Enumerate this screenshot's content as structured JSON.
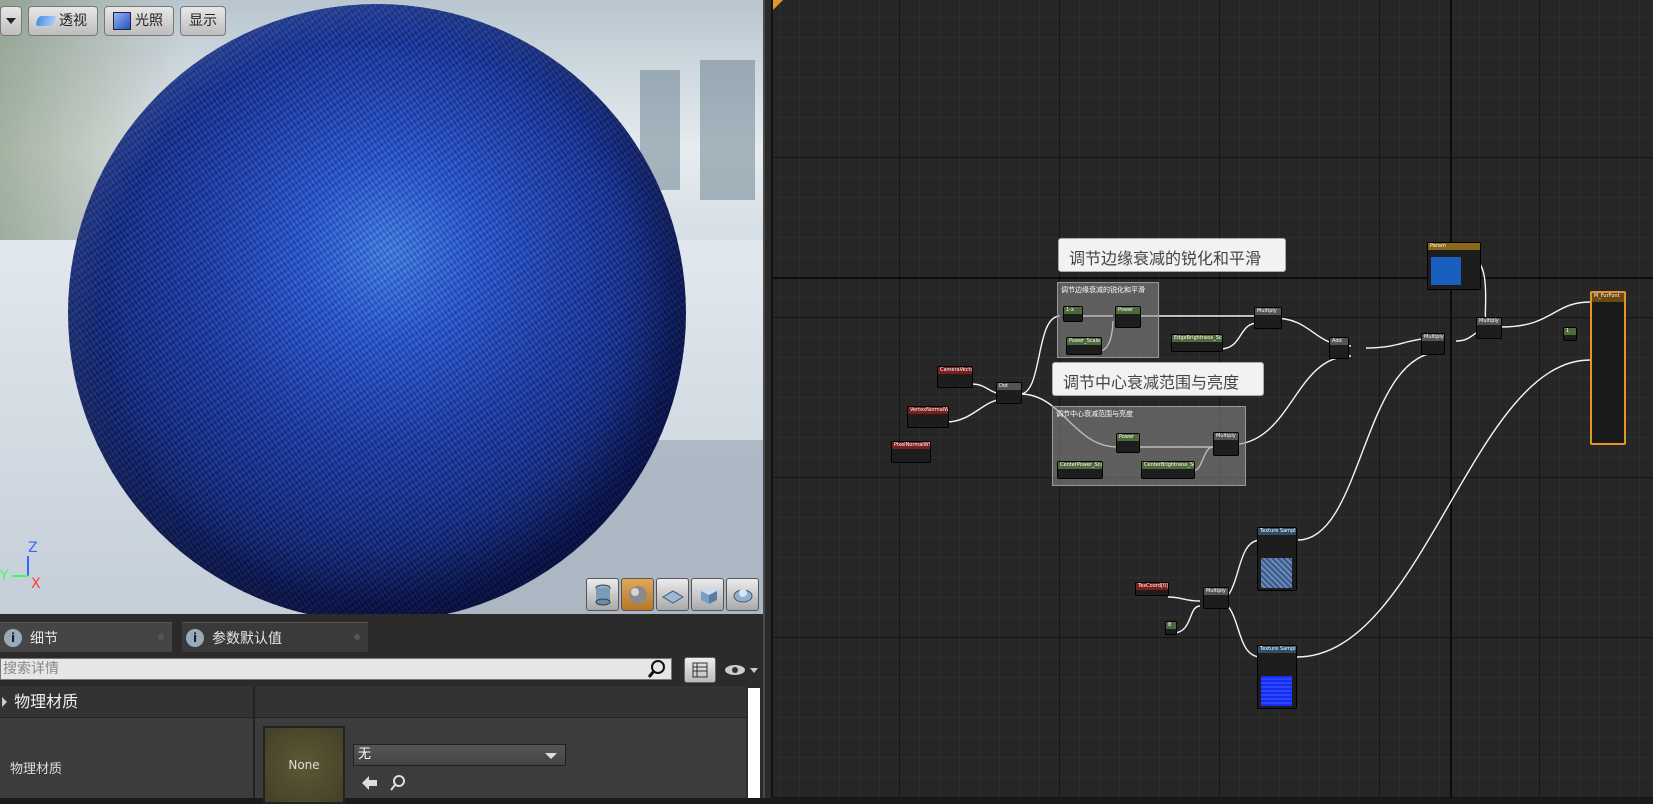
{
  "viewport": {
    "toolbar": {
      "dropdown_label": "",
      "perspective_label": "透视",
      "lighting_label": "光照",
      "show_label": "显示"
    },
    "axes": {
      "z": "Z",
      "y": "Y",
      "x": "X"
    },
    "preview_shapes": [
      "cylinder-icon",
      "sphere-icon",
      "plane-icon",
      "cube-icon",
      "custom-mesh-icon"
    ],
    "active_shape": "sphere-icon"
  },
  "details": {
    "tabs": [
      {
        "label": "细节"
      },
      {
        "label": "参数默认值"
      }
    ],
    "search_placeholder": "搜索详情",
    "section_title": "物理材质",
    "row_label": "物理材质",
    "thumbnail_text": "None",
    "combo_value": "无"
  },
  "graph": {
    "comments": [
      {
        "title": "调节边缘衰减的锐化和平滑"
      },
      {
        "title": "调节中心衰减范围与亮度"
      }
    ],
    "comment_boxes": [
      {
        "text": "调节边缘衰减的锐化和平滑"
      },
      {
        "text": "调节中心衰减范围与亮度"
      }
    ],
    "nodes": {
      "camera_vector": "CameraVector",
      "vertex_normal": "VertexNormalWS",
      "pixel_normal": "PixelNormalWS",
      "dot": "Dot",
      "one_minus": "1-x",
      "power_edge": "Power",
      "power_scale": "Power_Scale",
      "edge_brightness": "EdgeBrightness_Scale",
      "multiply_edge": "Multiply",
      "power_center": "Power",
      "center_power": "CenterPower_Scale",
      "center_brightness": "CenterBrightness_Scale",
      "multiply_center": "Multiply",
      "add": "Add",
      "multiply_a": "Multiply",
      "param_color": "Param",
      "multiply_b": "Multiply",
      "constant": "1",
      "tex_coord": "TexCoord[0]",
      "tex_multiply": "Multiply",
      "scalar": "8",
      "texture_sample_a": "Texture Sample",
      "texture_sample_b": "Texture Sample",
      "result": "M_FurFont"
    }
  },
  "colors": {
    "accent_orange": "#e0962a",
    "sphere_blue": "#2656d8",
    "param_color_swatch": "#1a5fc0",
    "texture_b_swatch": "#1a2ef0"
  }
}
